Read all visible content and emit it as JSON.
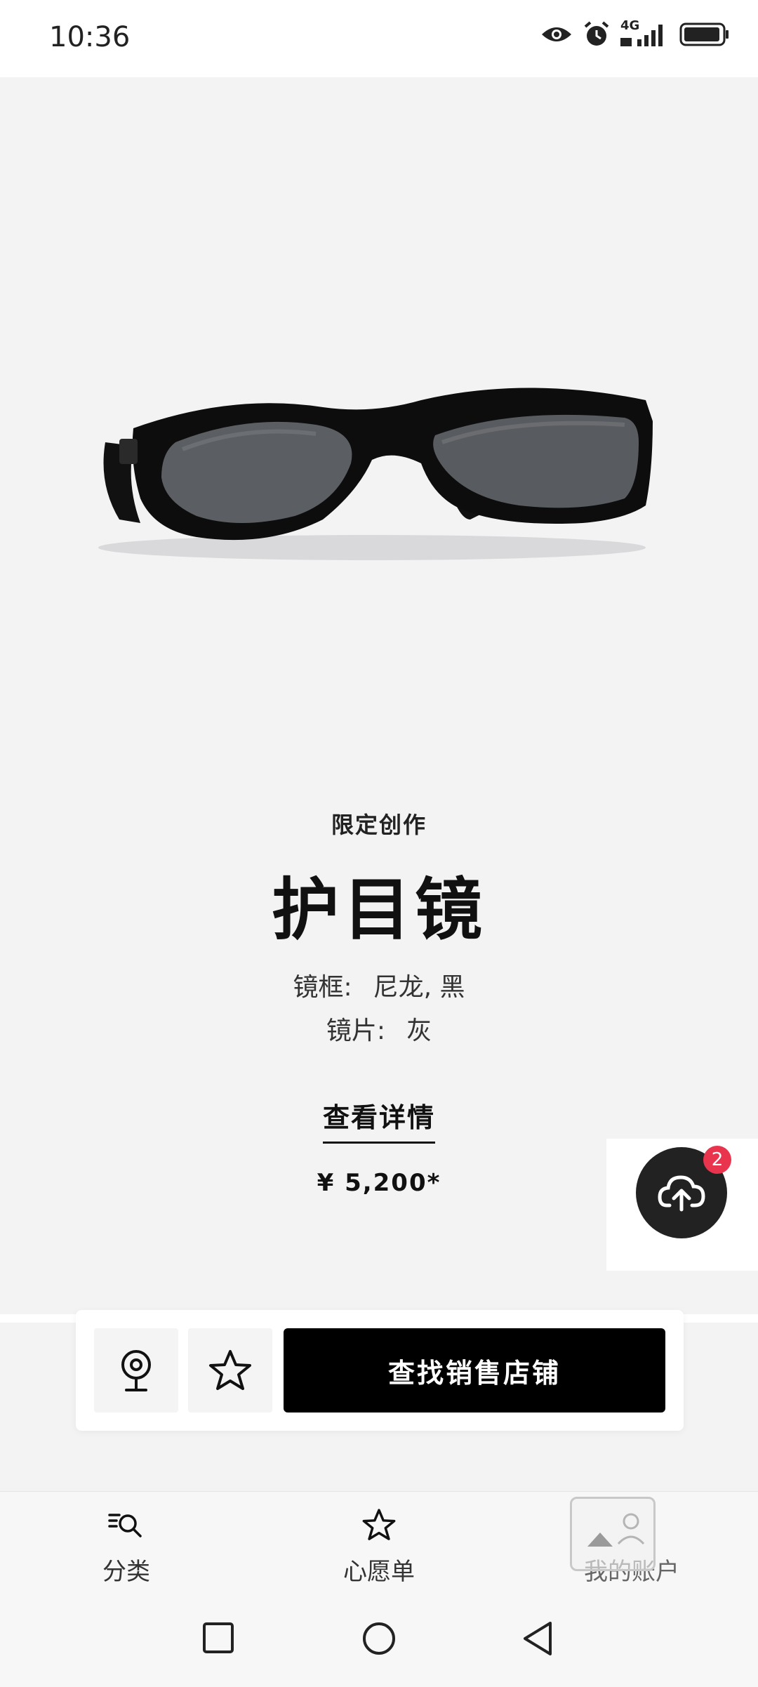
{
  "status_bar": {
    "time": "10:36",
    "network": "4G",
    "icons": [
      "eye-icon",
      "alarm-icon",
      "signal-icon",
      "battery-icon"
    ]
  },
  "product": {
    "eyebrow": "限定创作",
    "title": "护目镜",
    "frame_label": "镜框:",
    "frame_value": "尼龙, 黑",
    "lens_label": "镜片:",
    "lens_value": "灰",
    "details_link": "查看详情",
    "price": "¥ 5,200*"
  },
  "upload_widget": {
    "badge_count": "2"
  },
  "action_bar": {
    "find_store_label": "查找销售店铺"
  },
  "bottom_nav": {
    "items": [
      {
        "label": "分类",
        "icon": "category-search-icon"
      },
      {
        "label": "心愿单",
        "icon": "star-icon"
      },
      {
        "label": "我的账户",
        "icon": "account-icon"
      }
    ]
  },
  "colors": {
    "background": "#f3f3f4",
    "primary_button": "#000000",
    "badge": "#e8344d"
  }
}
